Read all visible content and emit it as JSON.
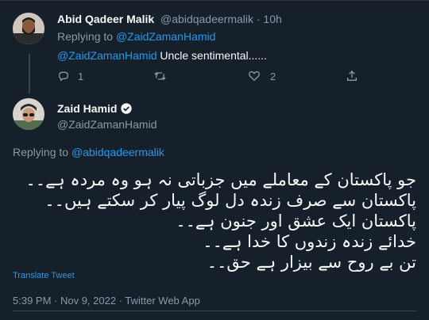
{
  "reply_tweet": {
    "author_name": "Abid Qadeer Malik",
    "handle_time": "@abidqadeermalik · 10h",
    "replying_prefix": "Replying to",
    "replying_handle": "@ZaidZamanHamid",
    "text_mention": "@ZaidZamanHamid",
    "text_body": " Uncle sentimental......",
    "actions": {
      "reply_count": "1",
      "retweet_count": "",
      "like_count": "2"
    }
  },
  "main_tweet": {
    "author_name": "Zaid Hamid",
    "handle": "@ZaidZamanHamid",
    "replying_prefix": "Replying to",
    "replying_handle": "@abidqadeermalik",
    "lines": [
      "جو پاکستان کے معاملے میں جزباتی نہ ہو وہ مردہ ہے۔۔",
      "پاکستان سے صرف زندہ دل لوگ پیار کر سکتے ہیں۔۔",
      "پاکستان ایک عشق اور جنون ہے۔۔",
      "خدائے زندہ زندوں کا خدا ہے۔۔",
      "تن بے روح سے بیزار ہے حق۔۔"
    ],
    "translate_label": "Translate Tweet",
    "timestamp": "5:39 PM · Nov 9, 2022 · Twitter Web App"
  },
  "colors": {
    "background": "#15202b",
    "link": "#1d9bf0",
    "muted": "#8b98a5"
  }
}
